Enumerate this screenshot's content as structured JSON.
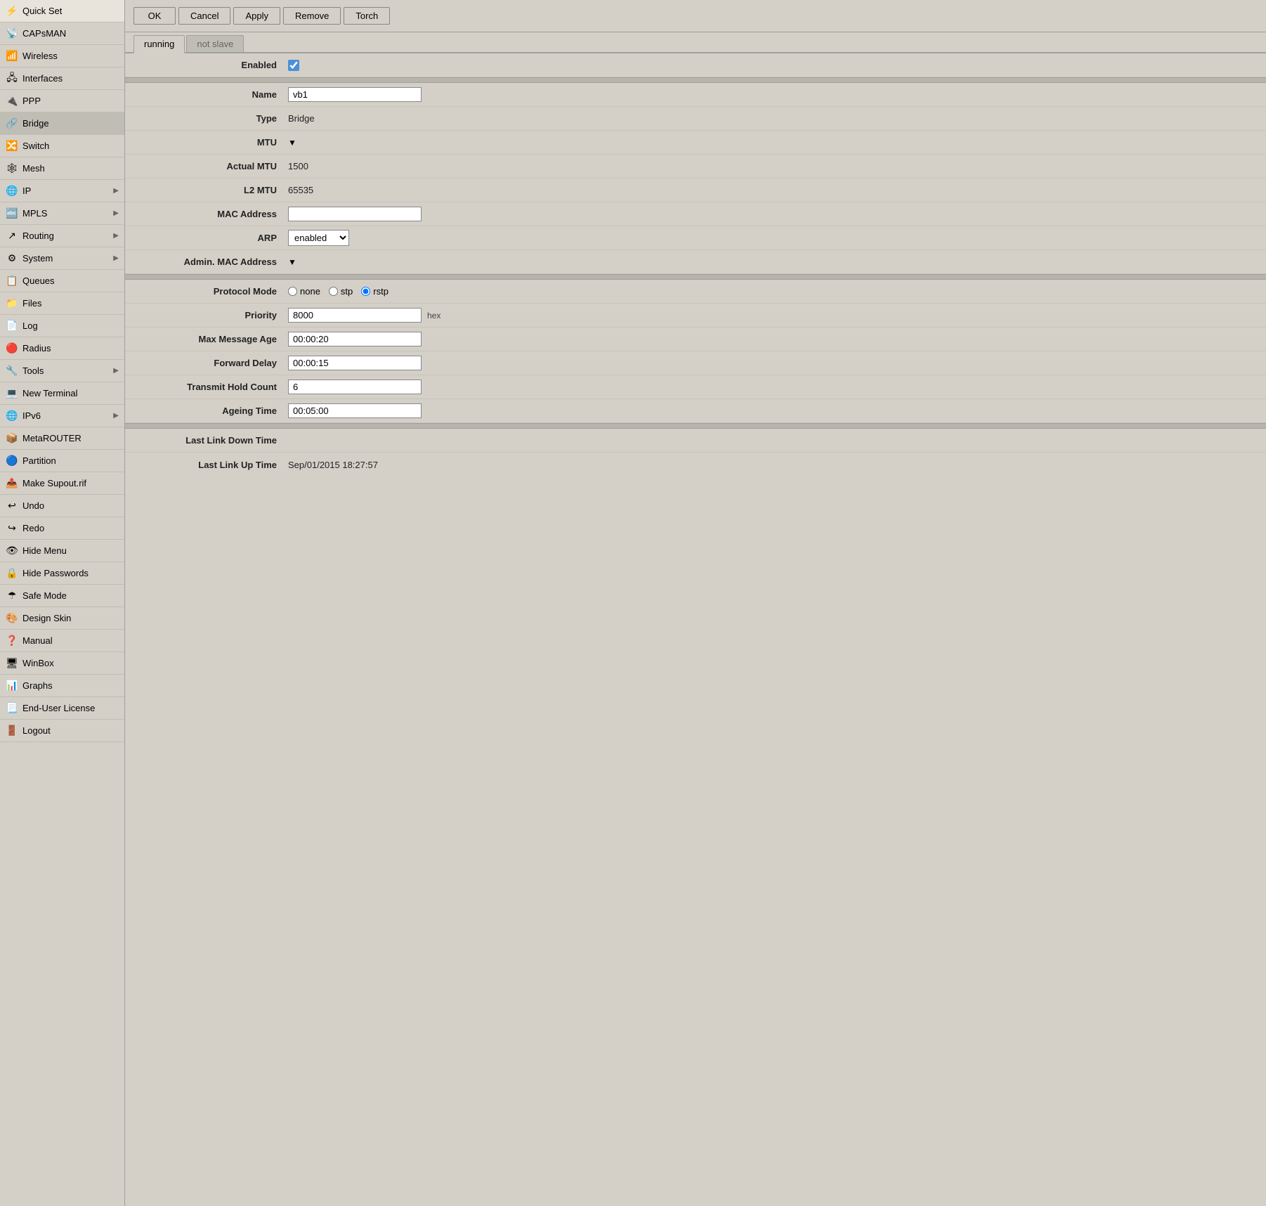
{
  "sidebar": {
    "items": [
      {
        "id": "quick-set",
        "label": "Quick Set",
        "icon": "⚡",
        "arrow": false,
        "active": false
      },
      {
        "id": "capsman",
        "label": "CAPsMAN",
        "icon": "📡",
        "arrow": false,
        "active": false
      },
      {
        "id": "wireless",
        "label": "Wireless",
        "icon": "📶",
        "arrow": false,
        "active": false
      },
      {
        "id": "interfaces",
        "label": "Interfaces",
        "icon": "🖧",
        "arrow": false,
        "active": false
      },
      {
        "id": "ppp",
        "label": "PPP",
        "icon": "🔌",
        "arrow": false,
        "active": false
      },
      {
        "id": "bridge",
        "label": "Bridge",
        "icon": "🔗",
        "arrow": false,
        "active": true
      },
      {
        "id": "switch",
        "label": "Switch",
        "icon": "🔀",
        "arrow": false,
        "active": false
      },
      {
        "id": "mesh",
        "label": "Mesh",
        "icon": "🕸",
        "arrow": false,
        "active": false
      },
      {
        "id": "ip",
        "label": "IP",
        "icon": "🌐",
        "arrow": true,
        "active": false
      },
      {
        "id": "mpls",
        "label": "MPLS",
        "icon": "🔤",
        "arrow": true,
        "active": false
      },
      {
        "id": "routing",
        "label": "Routing",
        "icon": "↗",
        "arrow": true,
        "active": false
      },
      {
        "id": "system",
        "label": "System",
        "icon": "⚙",
        "arrow": true,
        "active": false
      },
      {
        "id": "queues",
        "label": "Queues",
        "icon": "📋",
        "arrow": false,
        "active": false
      },
      {
        "id": "files",
        "label": "Files",
        "icon": "📁",
        "arrow": false,
        "active": false
      },
      {
        "id": "log",
        "label": "Log",
        "icon": "📄",
        "arrow": false,
        "active": false
      },
      {
        "id": "radius",
        "label": "Radius",
        "icon": "🔴",
        "arrow": false,
        "active": false
      },
      {
        "id": "tools",
        "label": "Tools",
        "icon": "🔧",
        "arrow": true,
        "active": false
      },
      {
        "id": "new-terminal",
        "label": "New Terminal",
        "icon": "💻",
        "arrow": false,
        "active": false
      },
      {
        "id": "ipv6",
        "label": "IPv6",
        "icon": "🌐",
        "arrow": true,
        "active": false
      },
      {
        "id": "metarouter",
        "label": "MetaROUTER",
        "icon": "📦",
        "arrow": false,
        "active": false
      },
      {
        "id": "partition",
        "label": "Partition",
        "icon": "🔵",
        "arrow": false,
        "active": false
      },
      {
        "id": "make-supout",
        "label": "Make Supout.rif",
        "icon": "📤",
        "arrow": false,
        "active": false
      },
      {
        "id": "undo",
        "label": "Undo",
        "icon": "↩",
        "arrow": false,
        "active": false
      },
      {
        "id": "redo",
        "label": "Redo",
        "icon": "↪",
        "arrow": false,
        "active": false
      },
      {
        "id": "hide-menu",
        "label": "Hide Menu",
        "icon": "👁",
        "arrow": false,
        "active": false
      },
      {
        "id": "hide-passwords",
        "label": "Hide Passwords",
        "icon": "🔒",
        "arrow": false,
        "active": false
      },
      {
        "id": "safe-mode",
        "label": "Safe Mode",
        "icon": "☂",
        "arrow": false,
        "active": false
      },
      {
        "id": "design-skin",
        "label": "Design Skin",
        "icon": "🎨",
        "arrow": false,
        "active": false
      },
      {
        "id": "manual",
        "label": "Manual",
        "icon": "❓",
        "arrow": false,
        "active": false
      },
      {
        "id": "winbox",
        "label": "WinBox",
        "icon": "🖥",
        "arrow": false,
        "active": false
      },
      {
        "id": "graphs",
        "label": "Graphs",
        "icon": "📊",
        "arrow": false,
        "active": false
      },
      {
        "id": "end-user-license",
        "label": "End-User License",
        "icon": "📃",
        "arrow": false,
        "active": false
      },
      {
        "id": "logout",
        "label": "Logout",
        "icon": "🚪",
        "arrow": false,
        "active": false
      }
    ]
  },
  "toolbar": {
    "ok_label": "OK",
    "cancel_label": "Cancel",
    "apply_label": "Apply",
    "remove_label": "Remove",
    "torch_label": "Torch"
  },
  "tabs": {
    "running_label": "running",
    "not_slave_label": "not slave"
  },
  "form": {
    "enabled_label": "Enabled",
    "name_label": "Name",
    "name_value": "vb1",
    "type_label": "Type",
    "type_value": "Bridge",
    "mtu_label": "MTU",
    "actual_mtu_label": "Actual MTU",
    "actual_mtu_value": "1500",
    "l2_mtu_label": "L2 MTU",
    "l2_mtu_value": "65535",
    "mac_address_label": "MAC Address",
    "arp_label": "ARP",
    "arp_value": "enabled",
    "admin_mac_label": "Admin. MAC Address",
    "protocol_mode_label": "Protocol Mode",
    "protocol_none": "none",
    "protocol_stp": "stp",
    "protocol_rstp": "rstp",
    "priority_label": "Priority",
    "priority_value": "8000",
    "hex_label": "hex",
    "max_message_age_label": "Max Message Age",
    "max_message_age_value": "00:00:20",
    "forward_delay_label": "Forward Delay",
    "forward_delay_value": "00:00:15",
    "transmit_hold_count_label": "Transmit Hold Count",
    "transmit_hold_count_value": "6",
    "ageing_time_label": "Ageing Time",
    "ageing_time_value": "00:05:00",
    "last_link_down_label": "Last Link Down Time",
    "last_link_up_label": "Last Link Up Time",
    "last_link_up_value": "Sep/01/2015 18:27:57"
  }
}
